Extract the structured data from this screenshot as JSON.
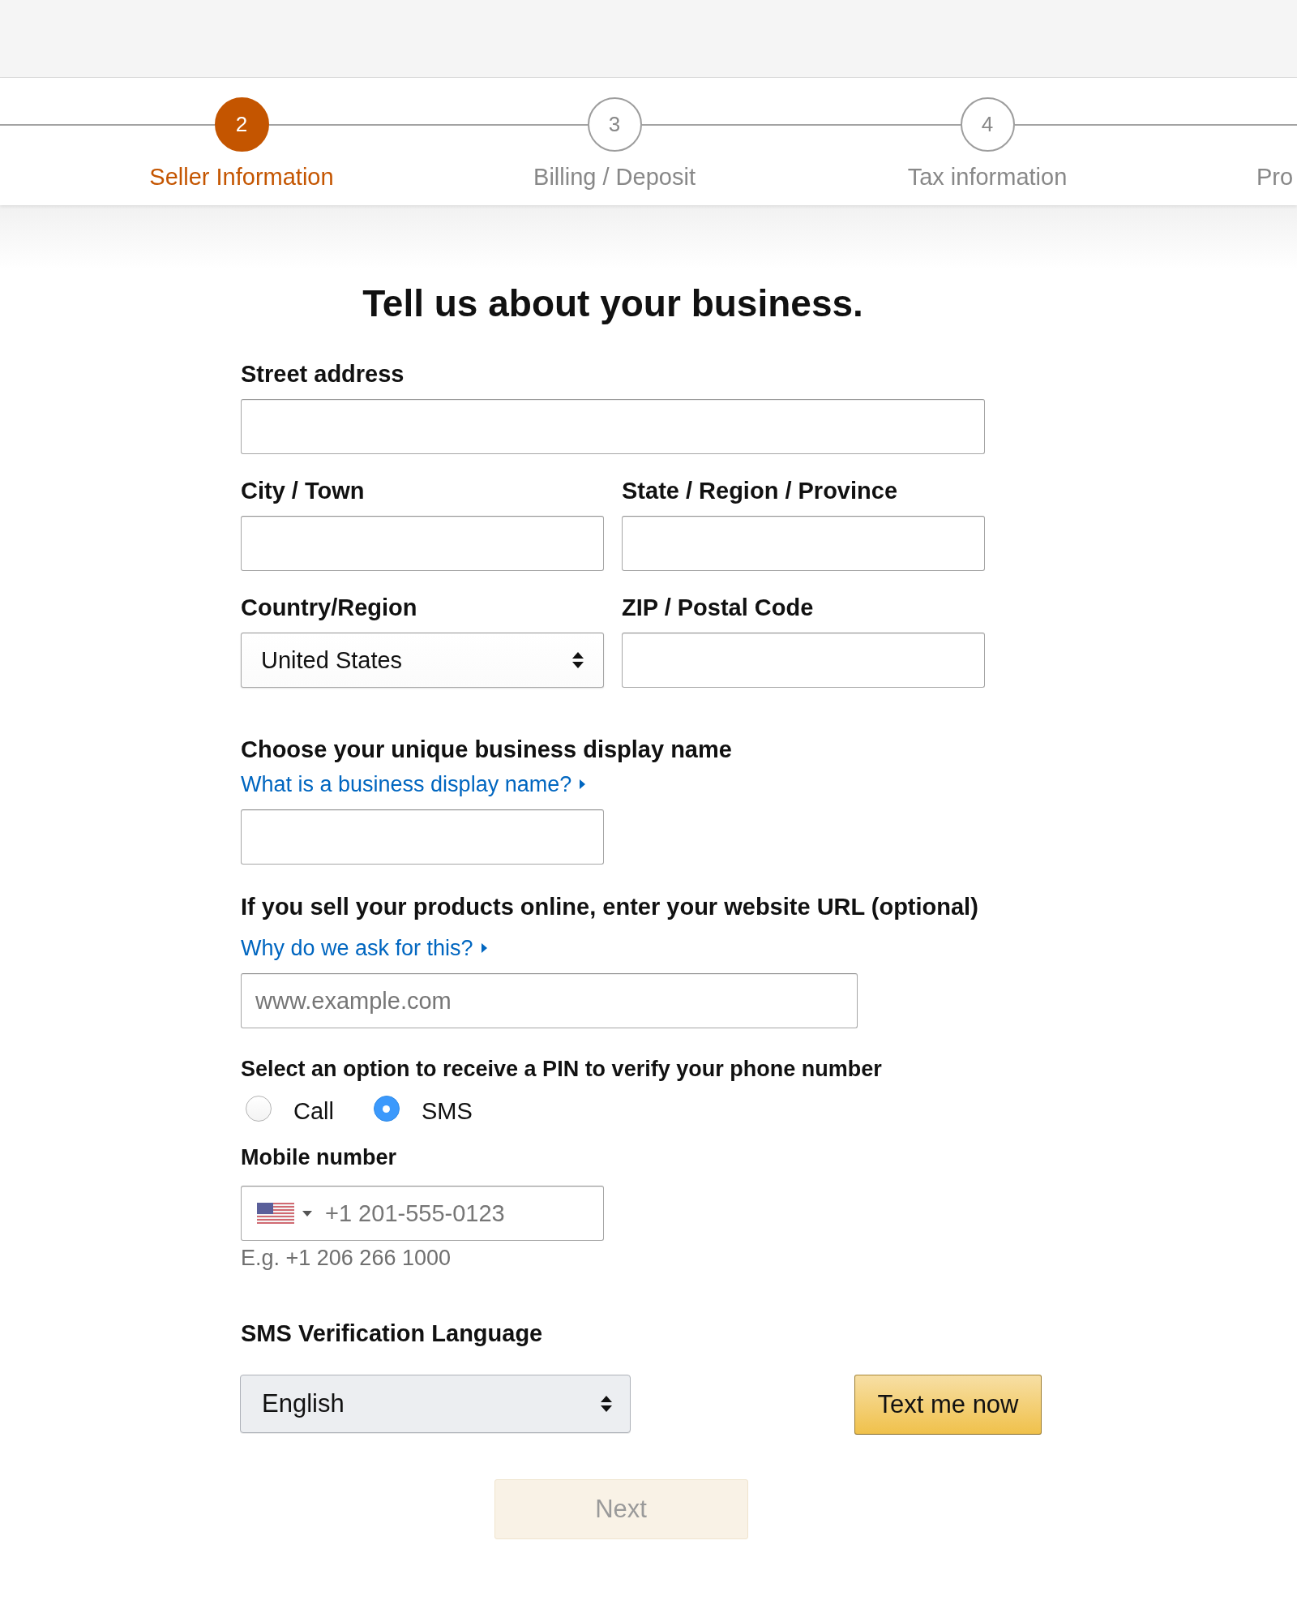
{
  "progress_steps": [
    {
      "number": "2",
      "label": "Seller Information",
      "selected": true
    },
    {
      "number": "3",
      "label": "Billing / Deposit",
      "selected": false
    },
    {
      "number": "4",
      "label": "Tax information",
      "selected": false
    },
    {
      "label": "Pro",
      "selected": false
    }
  ],
  "heading": "Tell us about your business.",
  "address_fields": [
    {
      "kind": "text",
      "label": "Street address"
    },
    {
      "kind": "text",
      "label": "City / Town"
    },
    {
      "kind": "text",
      "label": "State / Region / Province"
    },
    {
      "kind": "select",
      "label": "Country/Region",
      "value": "United States"
    },
    {
      "kind": "text",
      "label": "ZIP / Postal Code"
    }
  ],
  "display_name": {
    "label": "Choose your unique business display name",
    "help_link": "What is a business display name?"
  },
  "website": {
    "label": "If you sell your products online, enter your website URL (optional)",
    "help_link": "Why do we ask for this?",
    "placeholder": "www.example.com"
  },
  "pin_method": {
    "label": "Select an option to receive a PIN to verify your phone number",
    "options": [
      {
        "label": "Call",
        "selected": false
      },
      {
        "label": "SMS",
        "selected": true
      }
    ]
  },
  "mobile_number": {
    "label": "Mobile number",
    "placeholder": "+1 201-555-0123",
    "hint": "E.g. +1 206 266 1000"
  },
  "sms_language": {
    "label": "SMS Verification Language",
    "value": "English"
  },
  "text_me_button": {
    "label": "Text me now"
  },
  "next_button": {
    "label": "Next",
    "disabled": true
  }
}
